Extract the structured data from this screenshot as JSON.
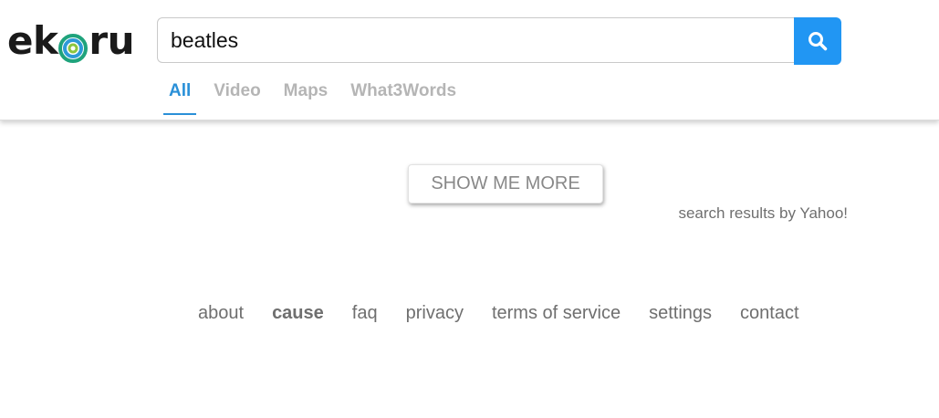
{
  "brand": {
    "logo_text_left": "ek",
    "logo_text_right": "ru",
    "accent_color": "#2196f3"
  },
  "search": {
    "value": "beatles",
    "button_icon": "search-icon"
  },
  "tabs": [
    {
      "label": "All",
      "active": true
    },
    {
      "label": "Video",
      "active": false
    },
    {
      "label": "Maps",
      "active": false
    },
    {
      "label": "What3Words",
      "active": false
    }
  ],
  "results": {
    "show_more_label": "SHOW ME MORE",
    "attribution": "search results by Yahoo!"
  },
  "footer": {
    "links": [
      "about",
      "cause",
      "faq",
      "privacy",
      "terms of service",
      "settings",
      "contact"
    ]
  }
}
